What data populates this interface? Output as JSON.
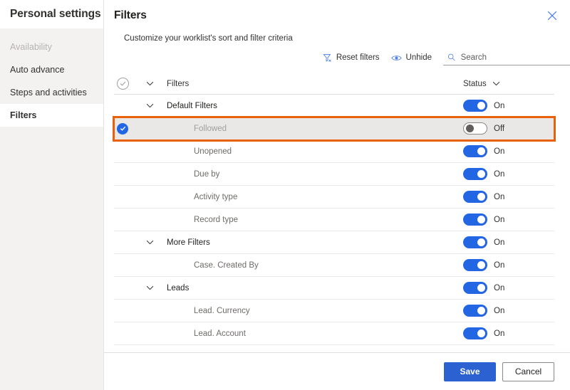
{
  "sidebar": {
    "title": "Personal settings",
    "items": [
      {
        "label": "Availability",
        "state": "disabled"
      },
      {
        "label": "Auto advance",
        "state": "normal"
      },
      {
        "label": "Steps and activities",
        "state": "normal"
      },
      {
        "label": "Filters",
        "state": "selected"
      }
    ]
  },
  "panel": {
    "title": "Filters",
    "subtitle": "Customize your worklist's sort and filter criteria",
    "close_icon": "close-icon"
  },
  "commandbar": {
    "reset_filters_label": "Reset filters",
    "reset_filters_icon": "filter-clear-icon",
    "unhide_label": "Unhide",
    "unhide_icon": "eye-icon",
    "search_icon": "search-icon",
    "search_placeholder": "Search",
    "search_value": ""
  },
  "table": {
    "header": {
      "select_all_icon": "circle-check-outline-icon",
      "expand_icon": "chevron-down-icon",
      "name_column": "Filters",
      "status_column": "Status",
      "status_sort_icon": "chevron-down-icon"
    },
    "rows": [
      {
        "label": "Default Filters",
        "level": "group",
        "expanded": true,
        "status": "On",
        "toggle": "on",
        "selected": false,
        "checked": false
      },
      {
        "label": "Followed",
        "level": "child",
        "expanded": false,
        "status": "Off",
        "toggle": "off",
        "selected": true,
        "checked": true
      },
      {
        "label": "Unopened",
        "level": "child",
        "expanded": false,
        "status": "On",
        "toggle": "on",
        "selected": false,
        "checked": false
      },
      {
        "label": "Due by",
        "level": "child",
        "expanded": false,
        "status": "On",
        "toggle": "on",
        "selected": false,
        "checked": false
      },
      {
        "label": "Activity type",
        "level": "child",
        "expanded": false,
        "status": "On",
        "toggle": "on",
        "selected": false,
        "checked": false
      },
      {
        "label": "Record type",
        "level": "child",
        "expanded": false,
        "status": "On",
        "toggle": "on",
        "selected": false,
        "checked": false
      },
      {
        "label": "More Filters",
        "level": "group",
        "expanded": true,
        "status": "On",
        "toggle": "on",
        "selected": false,
        "checked": false
      },
      {
        "label": "Case. Created By",
        "level": "child",
        "expanded": false,
        "status": "On",
        "toggle": "on",
        "selected": false,
        "checked": false
      },
      {
        "label": "Leads",
        "level": "group",
        "expanded": true,
        "status": "On",
        "toggle": "on",
        "selected": false,
        "checked": false
      },
      {
        "label": "Lead. Currency",
        "level": "child",
        "expanded": false,
        "status": "On",
        "toggle": "on",
        "selected": false,
        "checked": false
      },
      {
        "label": "Lead. Account",
        "level": "child",
        "expanded": false,
        "status": "On",
        "toggle": "on",
        "selected": false,
        "checked": false
      }
    ]
  },
  "footer": {
    "save_label": "Save",
    "cancel_label": "Cancel"
  },
  "colors": {
    "accent_blue": "#2266e3",
    "primary_button": "#2b61d1",
    "highlight_orange": "#e8610a",
    "sidebar_bg": "#f3f2f1",
    "selected_row_bg": "#e9e8e7"
  }
}
